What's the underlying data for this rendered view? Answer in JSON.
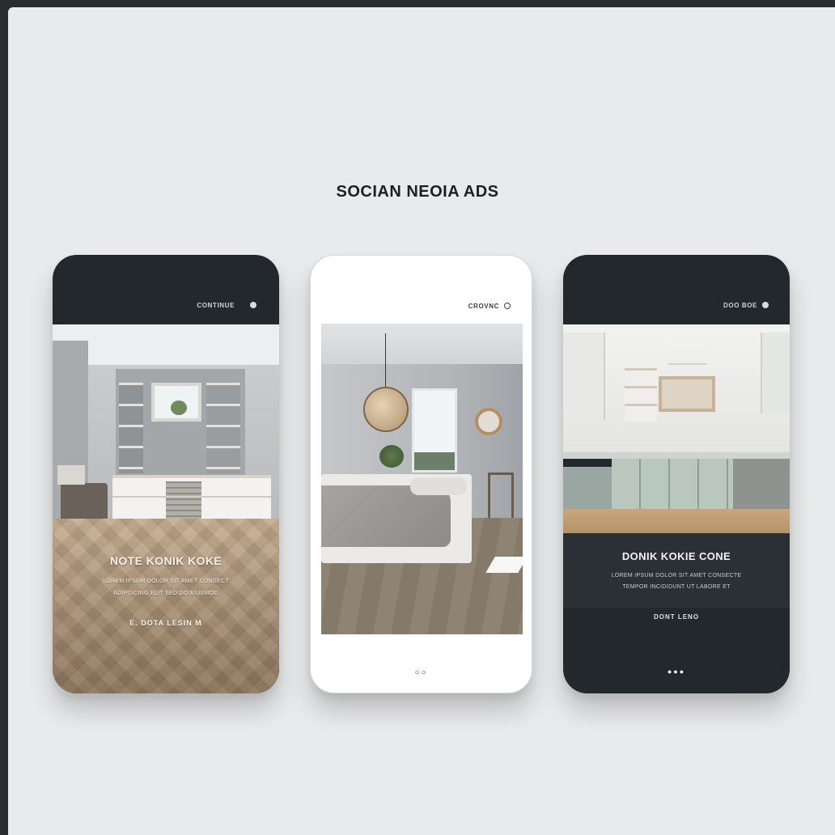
{
  "page": {
    "title": "SOCIAN NEOIA ADS"
  },
  "phones": [
    {
      "status_label": "CONTINUE",
      "headline": "NOTE KONIK KOKE",
      "body_lines": [
        "LOREM IPSUM DOLOR SIT AMET CONSECT",
        "ADIPISCING ELIT SED DO EIUSMOD"
      ],
      "cta": "E. DOTA  LESIN  M"
    },
    {
      "status_label": "CROVNC",
      "pager": "○○"
    },
    {
      "status_label": "DOO BOE",
      "headline": "DONIK KOKIE CONE",
      "body_lines": [
        "LOREM IPSUM DOLOR SIT AMET CONSECTE",
        "TEMPOR INCIDIDUNT UT LABORE ET"
      ],
      "cta": "DONT LENO",
      "pager": "●●●"
    }
  ]
}
